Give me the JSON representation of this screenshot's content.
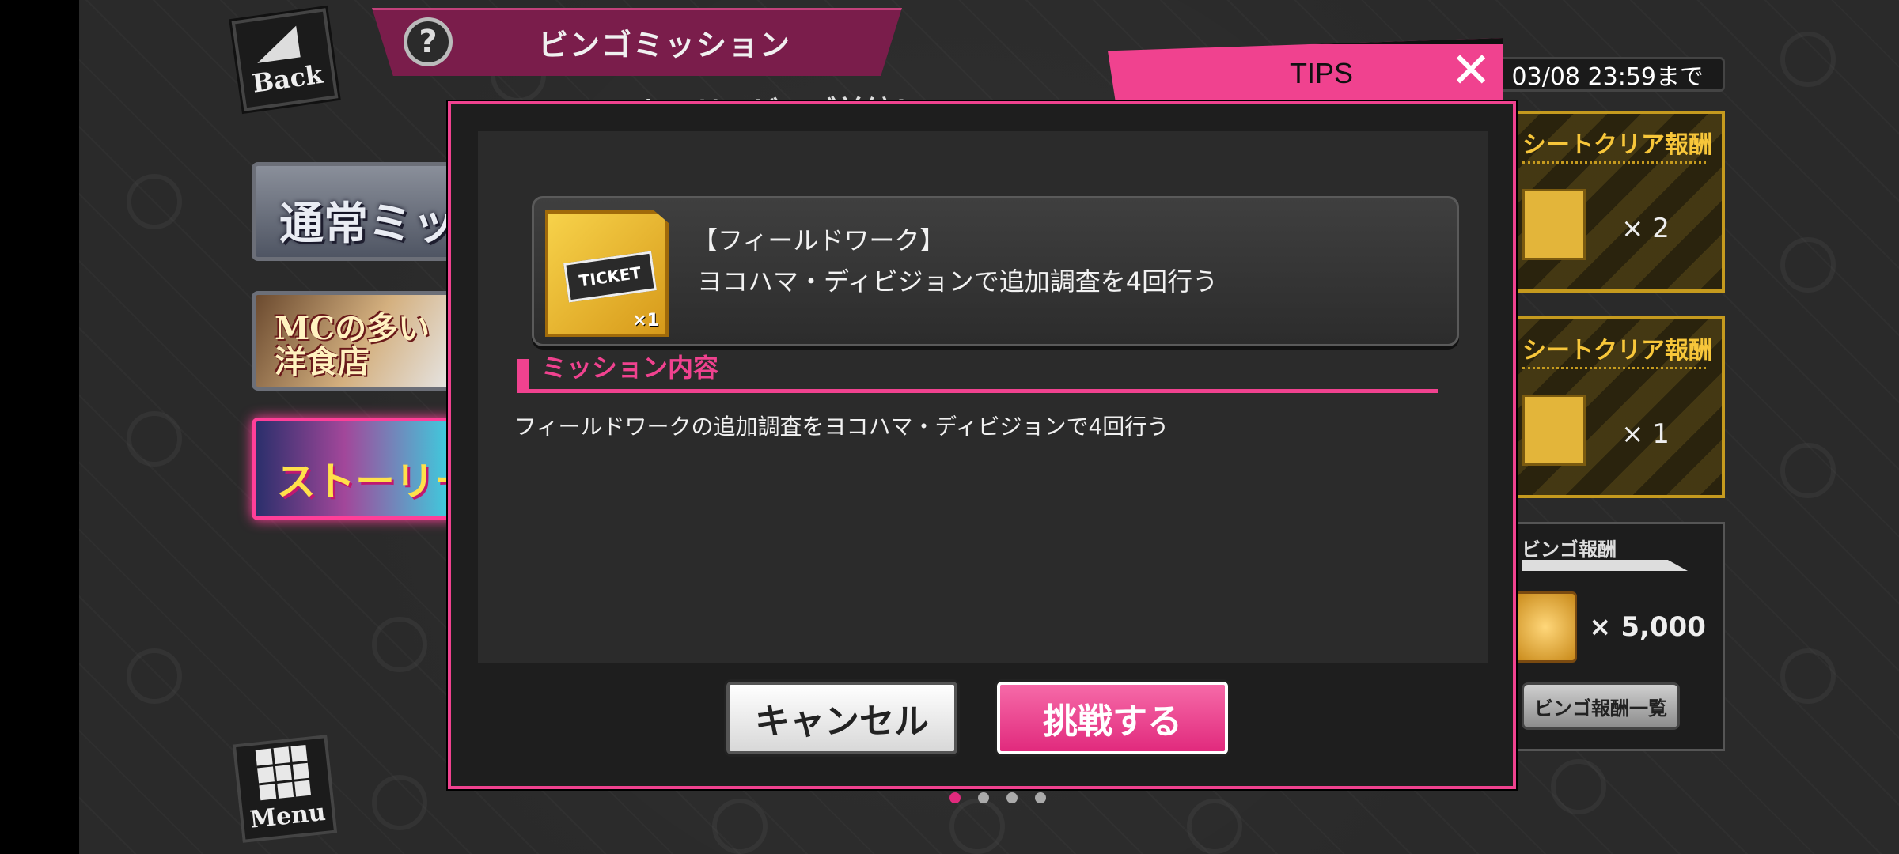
{
  "header": {
    "back_label": "Back",
    "help_icon": "?",
    "title": "ビンゴミッション",
    "menu_label": "Menu"
  },
  "left_tabs": [
    {
      "label": "通常ミッシ"
    },
    {
      "label": "MCの多い洋食店"
    },
    {
      "label": "ストーリーカード"
    }
  ],
  "subtitle": "ストーリービンゴ前編！",
  "right_panel": {
    "deadline": "03/08 23:59まで",
    "rewards": [
      {
        "title": "シートクリア報酬",
        "qty": "× 2"
      },
      {
        "title": "シートクリア報酬",
        "qty": "× 1"
      }
    ],
    "bingo": {
      "title": "ビンゴ報酬",
      "qty": "× 5,000",
      "list_button": "ビンゴ報酬一覧"
    }
  },
  "tips": {
    "label": "TIPS",
    "close": "✕"
  },
  "modal": {
    "mission": {
      "ticket_text": "TICKET",
      "ticket_count": "×1",
      "title": "【フィールドワーク】",
      "description": "ヨコハマ・ディビジョンで追加調査を4回行う"
    },
    "section_title": "ミッション内容",
    "section_body": "フィールドワークの追加調査をヨコハマ・ディビジョンで4回行う",
    "cancel_label": "キャンセル",
    "challenge_label": "挑戦する"
  },
  "pagination": {
    "total": 4,
    "active": 0
  },
  "colors": {
    "accent": "#f0428f",
    "gold": "#c59a1e"
  }
}
